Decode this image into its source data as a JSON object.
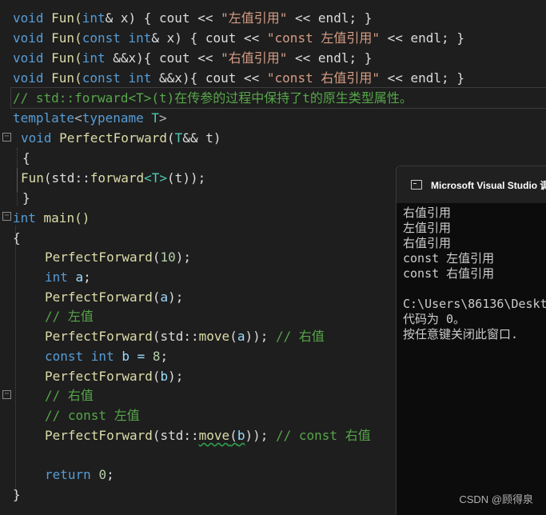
{
  "code": {
    "l1": {
      "a": "void",
      "b": " Fun(",
      "c": "int",
      "d": "& x) { cout << ",
      "e": "\"左值引用\"",
      "f": " << endl; }"
    },
    "l2": {
      "a": "void",
      "b": " Fun(",
      "c": "const int",
      "d": "& x) { cout << ",
      "e": "\"const 左值引用\"",
      "f": " << endl; }"
    },
    "l3": {
      "a": "void",
      "b": " Fun(",
      "c": "int",
      "d": " &&x){ cout << ",
      "e": "\"右值引用\"",
      "f": " << endl; }"
    },
    "l4": {
      "a": "void",
      "b": " Fun(",
      "c": "const int",
      "d": " &&x){ cout << ",
      "e": "\"const 右值引用\"",
      "f": " << endl; }"
    },
    "l5": "// std::forward<T>(t)在传参的过程中保持了t的原生类型属性。",
    "l6": {
      "a": "template",
      "b": "<",
      "c": "typename",
      "d": " T",
      "e": ">"
    },
    "l7": {
      "a": "void",
      "b": " PerfectForward",
      "c": "(",
      "d": "T",
      "e": "&& t)"
    },
    "l8": "{",
    "l9": {
      "a": "Fun",
      "b": "(std::",
      "c": "forward",
      "d": "<T>",
      "e": "(t));"
    },
    "l10": "}",
    "l11": {
      "a": "int",
      "b": " main()"
    },
    "l12": "{",
    "l14": {
      "a": "PerfectForward",
      "b": "(",
      "c": "10",
      "d": ");"
    },
    "l15": {
      "a": "int",
      "b": " a",
      "c": ";"
    },
    "l16": {
      "a": "PerfectForward",
      "b": "(",
      "c": "a",
      "d": ");"
    },
    "l17": "// 左值",
    "l18": {
      "a": "PerfectForward",
      "b": "(std::",
      "c": "move",
      "d": "(",
      "e": "a",
      "f": ")); ",
      "g": "// 右值"
    },
    "l19": {
      "a": "const int",
      "b": " b = ",
      "c": "8",
      "d": ";"
    },
    "l20": {
      "a": "PerfectForward",
      "b": "(",
      "c": "b",
      "d": ");"
    },
    "l21": "// 右值",
    "l22": "// const 左值",
    "l23": {
      "a": "PerfectForward",
      "b": "(std::",
      "c": "move",
      "d": "(",
      "e": "b",
      "f": ")); ",
      "g": "// const 右值"
    },
    "l25": {
      "a": "return",
      "b": " ",
      "c": "0",
      "d": ";"
    },
    "l26": "}"
  },
  "fold_markers": {
    "m1": "−",
    "m2": "−",
    "m3": "−"
  },
  "console": {
    "title": "Microsoft Visual Studio 调",
    "lines": [
      "右值引用",
      "左值引用",
      "右值引用",
      "const 左值引用",
      "const 右值引用",
      "",
      "C:\\Users\\86136\\Deskt",
      "代码为 0。",
      "按任意键关闭此窗口."
    ]
  },
  "watermark": "CSDN @顾得泉",
  "colors": {
    "background": "#1e1e1e",
    "keyword": "#569cd6",
    "function": "#dcdcaa",
    "string": "#d69d85",
    "comment": "#57a64a",
    "number": "#b5cea8",
    "variable": "#9cdcfe",
    "type": "#4ec9b0"
  }
}
